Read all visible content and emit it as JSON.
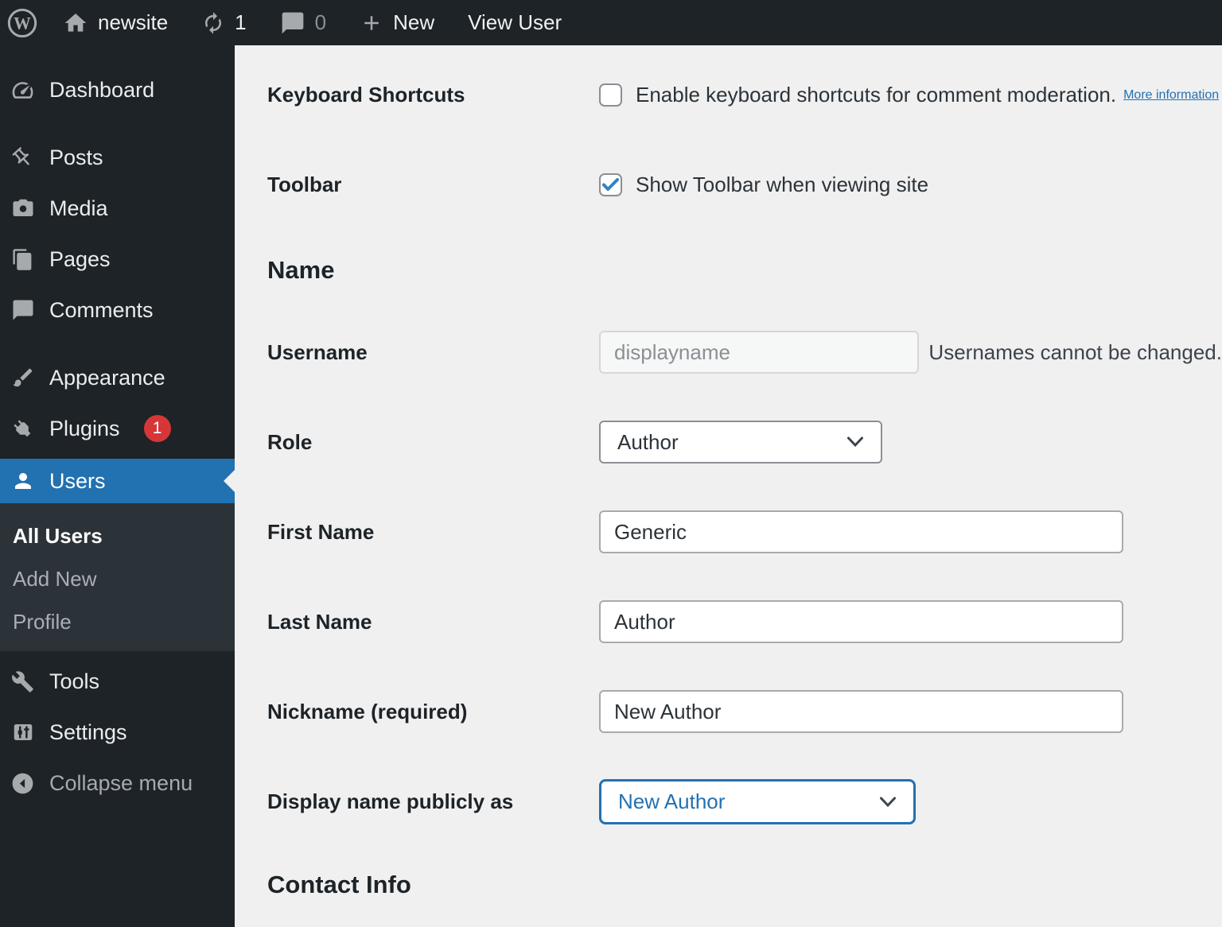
{
  "colors": {
    "accent_blue": "#2271b1",
    "badge_red": "#d63638",
    "checkmark_blue": "#3582c4",
    "admin_bar_bg": "#1d2327",
    "sidebar_bg": "#1d2327",
    "submenu_bg": "#2c3338",
    "content_bg": "#f0f0f1",
    "link_blue": "#2271b1"
  },
  "admin_bar": {
    "logo_icon": "wordpress-logo-icon",
    "site_name": "newsite",
    "updates_count": "1",
    "comments_count": "0",
    "new_label": "New",
    "view_user_label": "View User"
  },
  "sidebar": {
    "items": [
      {
        "label": "Dashboard",
        "icon": "dashboard-icon"
      },
      {
        "label": "Posts",
        "icon": "pushpin-icon"
      },
      {
        "label": "Media",
        "icon": "camera-icon"
      },
      {
        "label": "Pages",
        "icon": "pages-icon"
      },
      {
        "label": "Comments",
        "icon": "comment-bubble-icon"
      },
      {
        "label": "Appearance",
        "icon": "brush-icon"
      },
      {
        "label": "Plugins",
        "icon": "plug-icon",
        "badge": "1"
      },
      {
        "label": "Users",
        "icon": "person-icon",
        "current": true
      },
      {
        "label": "Tools",
        "icon": "wrench-icon"
      },
      {
        "label": "Settings",
        "icon": "sliders-icon"
      }
    ],
    "submenu_items": [
      "All Users",
      "Add New",
      "Profile"
    ],
    "submenu_current": "All Users",
    "collapse_label": "Collapse menu",
    "collapse_icon": "collapse-arrow-icon"
  },
  "form": {
    "keyboard_shortcuts": {
      "label": "Keyboard Shortcuts",
      "checked": false,
      "text": "Enable keyboard shortcuts for comment moderation.",
      "link": "More information"
    },
    "toolbar": {
      "label": "Toolbar",
      "checked": true,
      "text": "Show Toolbar when viewing site"
    },
    "name_section_heading": "Name",
    "username": {
      "label": "Username",
      "value": "displayname",
      "note": "Usernames cannot be changed."
    },
    "role": {
      "label": "Role",
      "selected": "Author"
    },
    "first_name": {
      "label": "First Name",
      "value": "Generic"
    },
    "last_name": {
      "label": "Last Name",
      "value": "Author"
    },
    "nickname": {
      "label": "Nickname (required)",
      "value": "New Author"
    },
    "display_name": {
      "label": "Display name publicly as",
      "selected": "New Author"
    },
    "contact_section_heading": "Contact Info"
  }
}
